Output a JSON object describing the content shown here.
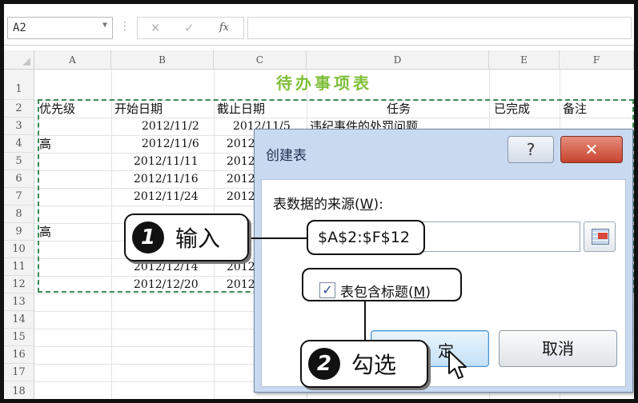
{
  "formula_bar": {
    "name_box": "A2",
    "separator": "⋮",
    "cancel": "✕",
    "enter": "✓",
    "fx": "fx",
    "formula": ""
  },
  "sheet": {
    "columns": [
      "A",
      "B",
      "C",
      "D",
      "E",
      "F"
    ],
    "rows": [
      "1",
      "2",
      "3",
      "4",
      "5",
      "6",
      "7",
      "8",
      "9",
      "10",
      "11",
      "12",
      "13",
      "14",
      "15",
      "16",
      "17",
      "18"
    ],
    "title": "待办事项表",
    "headers": {
      "a": "优先级",
      "b": "开始日期",
      "c": "截止日期",
      "d": "任务",
      "e": "已完成",
      "f": "备注"
    },
    "cells": {
      "r3_b": "2012/11/2",
      "r3_c": "2012/11/5",
      "r3_d": "违纪事件的处罚问题",
      "r4_a": "高",
      "r4_b": "2012/11/6",
      "r4_c": "2012",
      "r5_b": "2012/11/11",
      "r5_c": "2012",
      "r6_b": "2012/11/16",
      "r6_c": "2012",
      "r7_b": "2012/11/24",
      "r7_c": "2012",
      "r9_a": "高",
      "r11_b": "2012/12/14",
      "r11_c": "2012",
      "r12_b": "2012/12/20",
      "r12_c": "2012"
    }
  },
  "dialog": {
    "title": "创建表",
    "help": "?",
    "close": "✕",
    "source_label": "表数据的来源(",
    "source_key": "W",
    "source_suffix": "):",
    "range_value": "$A$2:$F$12",
    "checkbox_checked": "✓",
    "checkbox_label": "表包含标题(",
    "checkbox_key": "M",
    "checkbox_suffix": ")",
    "ok_label": "定",
    "cancel_label": "取消"
  },
  "callouts": [
    {
      "number": "1",
      "text": "输入"
    },
    {
      "number": "2",
      "text": "勾选"
    }
  ]
}
